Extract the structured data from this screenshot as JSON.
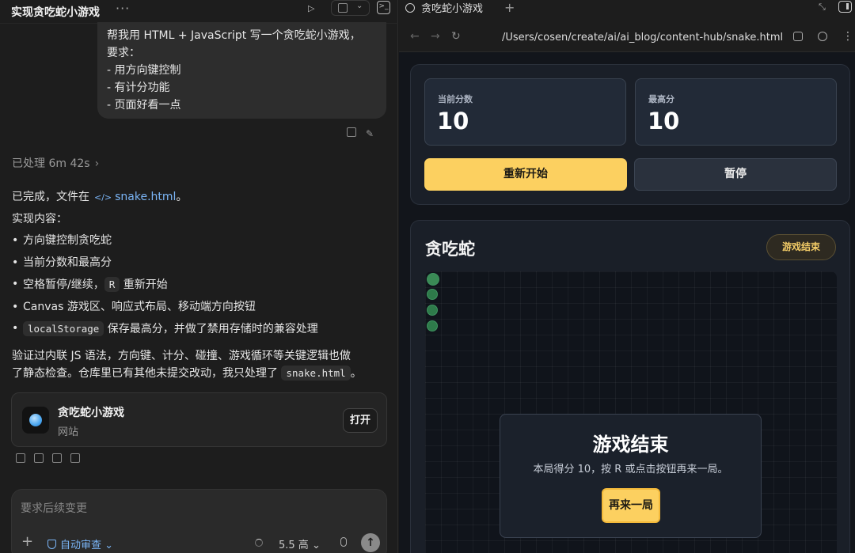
{
  "left": {
    "conversation_title": "实现贪吃蛇小游戏",
    "more_label": "···",
    "user_message": {
      "lines": [
        "帮我用 HTML + JavaScript 写一个贪吃蛇小游戏，",
        "要求：",
        "- 用方向键控制",
        "- 有计分功能",
        "- 页面好看一点"
      ]
    },
    "processed_label": "已处理 6m 42s",
    "answer": {
      "done_prefix": "已完成，文件在",
      "file_name": "snake.html",
      "done_suffix": "。",
      "impl_label": "实现内容：",
      "items": [
        {
          "text": "方向键控制贪吃蛇"
        },
        {
          "text": "当前分数和最高分"
        },
        {
          "pre": "空格暂停/继续，",
          "code": "R",
          "post": " 重新开始"
        },
        {
          "text": "Canvas 游戏区、响应式布局、移动端方向按钮"
        },
        {
          "code": "localStorage",
          "post": " 保存最高分，并做了禁用存储时的兼容处理"
        }
      ],
      "summary_line1": "验证过内联 JS 语法，方向键、计分、碰撞、游戏循环等关键逻辑也做",
      "summary_line2_pre": "了静态检查。仓库里已有其他未提交改动，我只处理了 ",
      "summary_line2_code": "snake.html",
      "summary_line2_post": "。"
    },
    "file_card": {
      "name": "贪吃蛇小游戏",
      "kind": "网站",
      "open_label": "打开"
    },
    "composer": {
      "placeholder": "要求后续变更",
      "plus": "+",
      "review_label": "自动审查",
      "model_label": "5.5 高",
      "send": "↑"
    }
  },
  "browser": {
    "tab_title": "贪吃蛇小游戏",
    "new_tab": "+",
    "url": "/Users/cosen/create/ai/ai_blog/content-hub/snake.html"
  },
  "game": {
    "current_score_label": "当前分数",
    "current_score": "10",
    "best_score_label": "最高分",
    "best_score": "10",
    "restart_label": "重新开始",
    "pause_label": "暂停",
    "title": "贪吃蛇",
    "status": "游戏结束",
    "overlay_title": "游戏结束",
    "overlay_message": "本局得分 10，按 R 或点击按钮再来一局。",
    "overlay_button": "再来一局",
    "snake_cells": [
      [
        0,
        0
      ],
      [
        0,
        1
      ],
      [
        0,
        2
      ],
      [
        0,
        3
      ]
    ],
    "colors": {
      "accent": "#fcd060",
      "snake": "#2e7a4a",
      "link": "#7ab4f5"
    }
  }
}
